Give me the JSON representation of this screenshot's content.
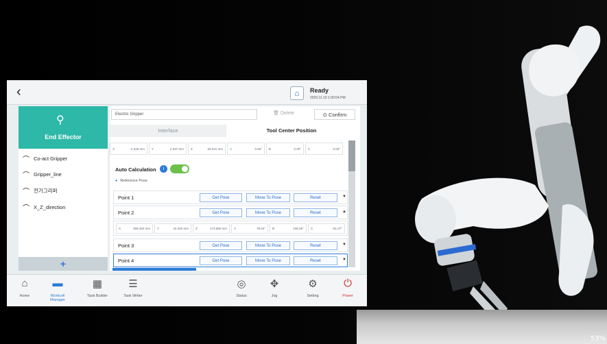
{
  "status": {
    "state": "Ready",
    "datetime": "2020.11.19 1:00:04 PM"
  },
  "sidebar": {
    "title": "End Effector",
    "items": [
      {
        "label": "Co-act Gripper"
      },
      {
        "label": "Gripper_line"
      },
      {
        "label": "전기그리퍼"
      },
      {
        "label": "X_Z_direction"
      }
    ],
    "add_label": "+"
  },
  "editor": {
    "name": "Electric Gripper",
    "delete_label": "Delete",
    "confirm_label": "Confirm",
    "tabs": [
      "Interface",
      "Tool Center Position"
    ],
    "coords": [
      [
        "X",
        "-4.345 mm"
      ],
      [
        "Y",
        "2.337 mm"
      ],
      [
        "Z",
        "26.031 mm"
      ],
      [
        "A",
        "0.00°"
      ],
      [
        "B",
        "0.00°"
      ],
      [
        "C",
        "0.00°"
      ]
    ],
    "auto_calc_label": "Auto Calculation",
    "reference_label": "Reference Pose",
    "points": [
      {
        "label": "Point 1"
      },
      {
        "label": "Point 2"
      },
      {
        "label": "Point 3"
      },
      {
        "label": "Point 4"
      }
    ],
    "point2_coords": [
      [
        "X",
        "359.450 mm"
      ],
      [
        "Y",
        "42.320 mm"
      ],
      [
        "Z",
        "173.680 mm"
      ],
      [
        "A",
        "78.02°"
      ],
      [
        "B",
        "106.59°"
      ],
      [
        "C",
        "-91.37°"
      ]
    ],
    "get_pose": "Get Pose",
    "move_to_pose": "Move To Pose",
    "reset": "Reset"
  },
  "nav": [
    {
      "label": "Home",
      "icon": "home-icon"
    },
    {
      "label": "Workcell Manager",
      "icon": "workcell-icon"
    },
    {
      "label": "Task Builder",
      "icon": "task-builder-icon"
    },
    {
      "label": "Task Writer",
      "icon": "task-writer-icon"
    },
    {
      "label": "Status",
      "icon": "status-icon"
    },
    {
      "label": "Jog",
      "icon": "jog-icon"
    },
    {
      "label": "Setting",
      "icon": "gear-icon"
    },
    {
      "label": "Power",
      "icon": "power-icon"
    }
  ],
  "zoom": "53%",
  "colors": {
    "accent": "#2b7bd8",
    "teal": "#2db8a8",
    "toggle": "#6cc04a",
    "power": "#d03030"
  }
}
